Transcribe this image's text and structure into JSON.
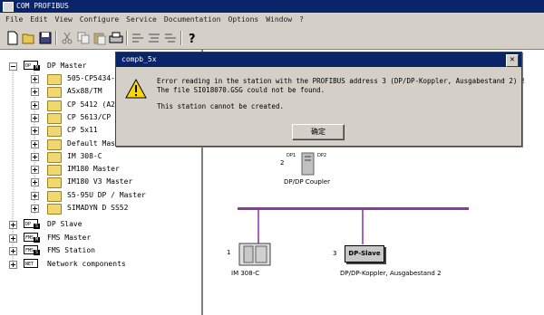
{
  "window": {
    "title": "COM PROFIBUS"
  },
  "menu": [
    "File",
    "Edit",
    "View",
    "Configure",
    "Service",
    "Documentation",
    "Options",
    "Window",
    "?"
  ],
  "toolbar": {
    "icons": [
      "new-icon",
      "open-icon",
      "save-icon",
      "cut-icon",
      "copy-icon",
      "paste-icon",
      "print-icon",
      "tool1-icon",
      "tool2-icon",
      "tool3-icon",
      "help-icon"
    ]
  },
  "tree": {
    "dp_master": {
      "label": "DP Master",
      "icon_text": "DP",
      "icon_sub": "M"
    },
    "children": [
      "505-CP5434-I",
      "ASx88/TM",
      "CP 5412 (A2)",
      "CP 5613/CP 5",
      "CP 5x11",
      "Default Master",
      "IM 308-C",
      "IM180 Master",
      "IM180 V3 Master",
      "S5-95U DP / Master",
      "SIMADYN D SS52"
    ],
    "dp_slave": {
      "label": "DP Slave",
      "icon_text": "DP",
      "icon_sub": "S"
    },
    "fms_master": {
      "label": "FMS Master",
      "icon_text": "FMS",
      "icon_sub": "M"
    },
    "fms_station": {
      "label": "FMS Station",
      "icon_text": "FMS",
      "icon_sub": "S"
    },
    "network": {
      "label": "Network components",
      "icon_text": "NET"
    }
  },
  "dialog": {
    "title": "compb_5x",
    "line1": "Error reading in the station with the PROFIBUS address 3 (DP/DP-Koppler, Ausgabestand 2) !",
    "line2": "The file SI018070.GSG could not be found.",
    "line3": "This station cannot be created.",
    "ok_label": "确定"
  },
  "diagram": {
    "coupler": {
      "num": "2",
      "dp1": "DP1",
      "dp2": "DP2",
      "label": "DP/DP Coupler"
    },
    "station1": {
      "num": "1",
      "label": "IM 308-C"
    },
    "station3": {
      "num": "3",
      "box": "DP-Slave",
      "label": "DP/DP-Koppler, Ausgabestand 2"
    }
  },
  "colors": {
    "titlebar": "#0a246a",
    "bus": "#8a3a9a",
    "face": "#d4d0c8"
  }
}
